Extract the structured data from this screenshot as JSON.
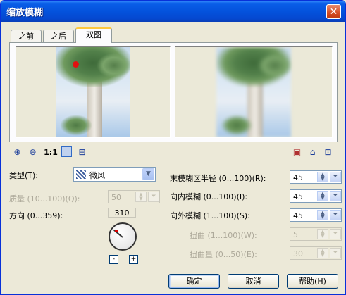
{
  "title": "缩放模糊",
  "close_glyph": "✕",
  "tabs": [
    {
      "label": "之前"
    },
    {
      "label": "之后"
    },
    {
      "label": "双图"
    }
  ],
  "toolbar": {
    "zoom_in": "zoom-in-icon",
    "zoom_out": "zoom-out-icon",
    "actual_size_label": "1:1"
  },
  "type_label": "类型(T):",
  "type_value": "微风",
  "quality_label": "质量 (10...100)(Q):",
  "quality_value": "50",
  "direction_label": "方向 (0...359):",
  "direction_value": "310",
  "dial_minus": "-",
  "dial_plus": "+",
  "radius_label": "末模糊区半径 (0...100)(R):",
  "radius_value": "45",
  "inward_label": "向内模糊 (0...100)(I):",
  "inward_value": "45",
  "outward_label": "向外模糊 (1...100)(S):",
  "outward_value": "45",
  "twist_label": "扭曲 (1...100)(W):",
  "twist_value": "5",
  "twist_amount_label": "扭曲量 (0...50)(E):",
  "twist_amount_value": "30",
  "buttons": {
    "ok": "确定",
    "cancel": "取消",
    "help": "帮助(H)"
  }
}
